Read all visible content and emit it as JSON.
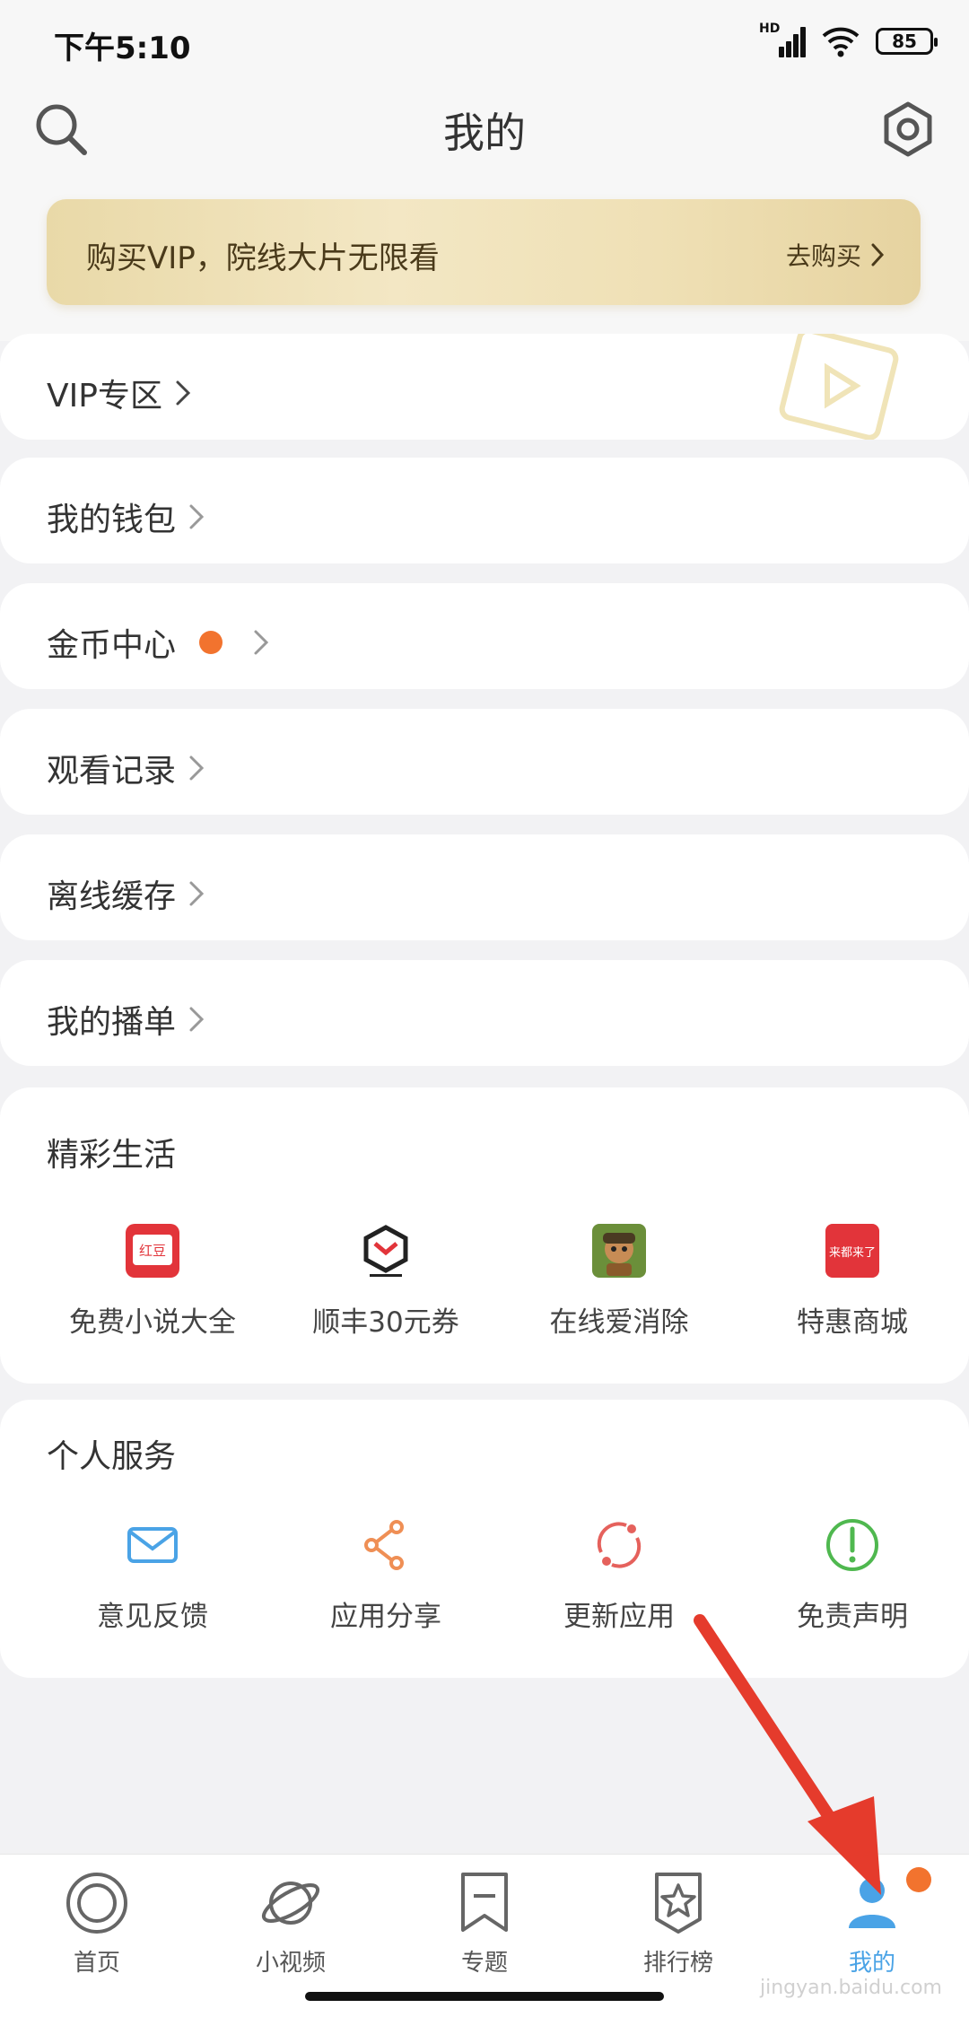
{
  "status_bar": {
    "time": "下午5:10",
    "network_badge": "HD",
    "battery": "85"
  },
  "header": {
    "title": "我的",
    "search_icon": "search-icon",
    "settings_icon": "gear-icon"
  },
  "vip_banner": {
    "text": "购买VIP，院线大片无限看",
    "action": "去购买"
  },
  "menu": [
    {
      "label": "VIP专区",
      "has_badge": false
    },
    {
      "label": "我的钱包",
      "has_badge": false
    },
    {
      "label": "金币中心",
      "has_badge": true
    },
    {
      "label": "观看记录",
      "has_badge": false
    },
    {
      "label": "离线缓存",
      "has_badge": false
    },
    {
      "label": "我的播单",
      "has_badge": false
    }
  ],
  "life": {
    "title": "精彩生活",
    "items": [
      {
        "label": "免费小说大全",
        "icon": "red-book-icon",
        "icon_text": "红豆"
      },
      {
        "label": "顺丰30元券",
        "icon": "sf-hexagon-icon",
        "icon_text": ""
      },
      {
        "label": "在线爱消除",
        "icon": "game-character-icon",
        "icon_text": ""
      },
      {
        "label": "特惠商城",
        "icon": "shop-icon",
        "icon_text": "来都来了"
      }
    ]
  },
  "services": {
    "title": "个人服务",
    "items": [
      {
        "label": "意见反馈",
        "icon": "mail-icon",
        "color": "#4aa3e6"
      },
      {
        "label": "应用分享",
        "icon": "share-icon",
        "color": "#ef8f55"
      },
      {
        "label": "更新应用",
        "icon": "refresh-icon",
        "color": "#e5615c"
      },
      {
        "label": "免责声明",
        "icon": "exclamation-circle-icon",
        "color": "#4fb84f"
      }
    ]
  },
  "tabbar": {
    "tabs": [
      {
        "label": "首页",
        "icon": "target-icon"
      },
      {
        "label": "小视频",
        "icon": "planet-icon"
      },
      {
        "label": "专题",
        "icon": "bookmark-icon"
      },
      {
        "label": "排行榜",
        "icon": "star-badge-icon"
      },
      {
        "label": "我的",
        "icon": "user-icon",
        "active": true
      }
    ]
  },
  "colors": {
    "accent": "#4aa3e6",
    "badge": "#f2732e",
    "annotation": "#e53b2c"
  },
  "watermark": "jingyan.baidu.com"
}
